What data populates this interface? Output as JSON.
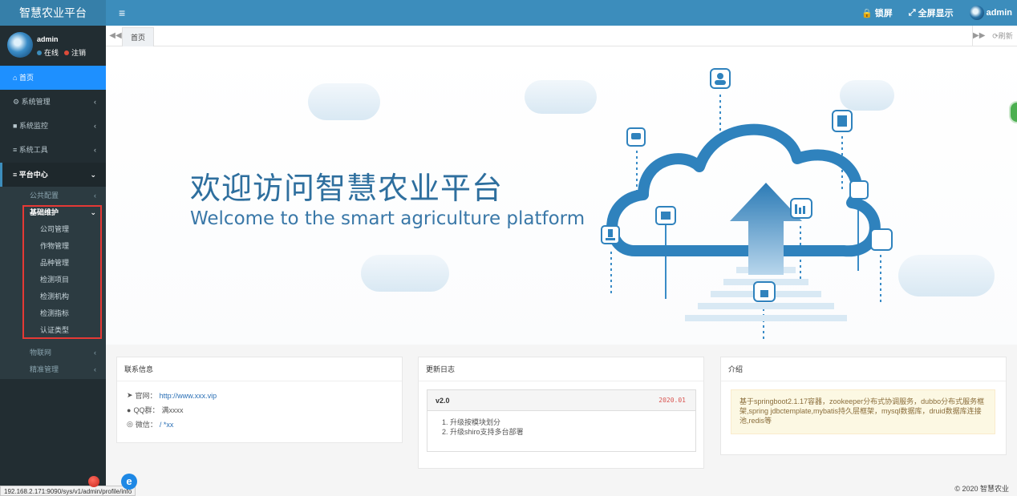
{
  "app": {
    "title": "智慧农业平台"
  },
  "topbar": {
    "lock": "锁屏",
    "fullscreen": "全屏显示",
    "user": "admin",
    "menu_icon": "≡"
  },
  "sidebar": {
    "user": {
      "name": "admin",
      "online": "在线",
      "logout": "注销"
    },
    "items": [
      {
        "icon": "⌂",
        "label": "首页"
      },
      {
        "icon": "⚙",
        "label": "系统管理"
      },
      {
        "icon": "■",
        "label": "系统监控"
      },
      {
        "icon": "≡",
        "label": "系统工具"
      },
      {
        "icon": "≡",
        "label": "平台中心"
      }
    ],
    "sub": {
      "public_config": "公共配置",
      "basic_maintenance": "基础维护",
      "basic_items": [
        "公司管理",
        "作物管理",
        "品种管理",
        "检测项目",
        "检测机构",
        "检测指标",
        "认证类型"
      ],
      "iot": "物联网",
      "precision": "精准管理"
    }
  },
  "tabs": {
    "home": "首页",
    "refresh": "刷新"
  },
  "hero": {
    "title": "欢迎访问智慧农业平台",
    "subtitle": "Welcome to the smart agriculture platform"
  },
  "panels": {
    "contact": {
      "title": "联系信息",
      "website_label": "官网：",
      "website_value": "http://www.xxx.vip",
      "qq_label": "QQ群：",
      "qq_value": "满xxxx",
      "wechat_label": "微信：",
      "wechat_value": "/ *xx"
    },
    "changelog": {
      "title": "更新日志",
      "version": "v2.0",
      "date": "2020.01",
      "items": [
        "升级按模块划分",
        "升级shiro支持多台部署"
      ]
    },
    "intro": {
      "title": "介绍",
      "text": "基于springboot2.1.17容器，zookeeper分布式协调服务，dubbo分布式服务框架,spring jdbctemplate,mybatis持久层框架，mysql数据库，druid数据库连接池,redis等"
    }
  },
  "footer": {
    "copyright": "© 2020 智慧农业"
  },
  "statusbar": {
    "url": "192.168.2.171:9090/sys/v1/admin/profile/info"
  },
  "colors": {
    "header": "#3c8dbc",
    "logo": "#367fa9",
    "sidebar": "#222d32",
    "active": "#1e90ff",
    "hero_text": "#2e6f9e"
  }
}
